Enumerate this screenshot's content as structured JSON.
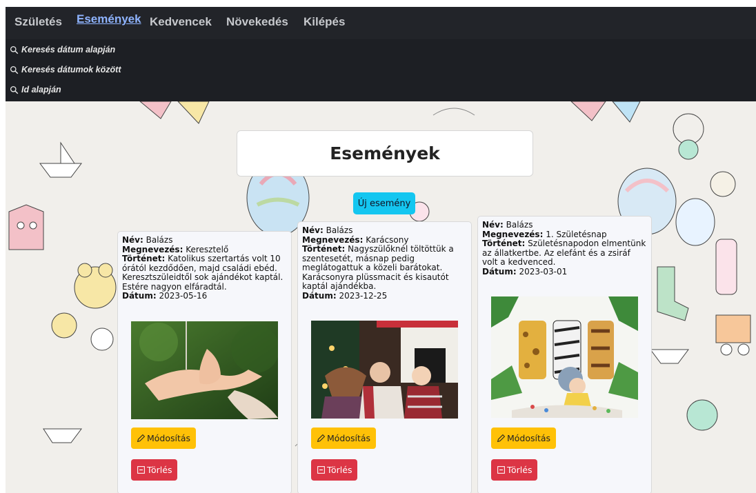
{
  "nav": {
    "items": [
      {
        "label": "Születés"
      },
      {
        "label": "Események"
      },
      {
        "label": "Kedvencek"
      },
      {
        "label": "Növekedés"
      },
      {
        "label": "Kilépés"
      }
    ]
  },
  "subnav": {
    "items": [
      {
        "label": "Keresés dátum alapján",
        "icon": "search-icon"
      },
      {
        "label": "Keresés dátumok között",
        "icon": "search-icon"
      },
      {
        "label": "Id alapján",
        "icon": "search-icon"
      }
    ]
  },
  "page": {
    "title": "Események",
    "new_button": "Új esemény"
  },
  "labels": {
    "name": "Név:",
    "title": "Megnevezés:",
    "story": "Történet:",
    "date": "Dátum:",
    "edit": "Módosítás",
    "delete": "Törlés"
  },
  "cards": [
    {
      "name": "Balázs",
      "title": "Keresztelő",
      "story": "Katolikus szertartás volt 10 órától kezdődően, majd családi ebéd. Keresztszüleidtől sok ajándékot kaptál. Estére nagyon elfáradtál.",
      "date": "2023-05-16"
    },
    {
      "name": "Balázs",
      "title": "Karácsony",
      "story": "Nagyszülőknél töltöttük a szentesetét, másnap pedig meglátogattuk a közeli barátokat. Karácsonyra plüssmacit és kisautót kaptál ajándékba.",
      "date": "2023-12-25"
    },
    {
      "name": "Balázs",
      "title": "1. Születésnap",
      "story": "Születésnapodon elmentünk az állatkertbe. Az elefánt és a zsiráf volt a kedvenced.",
      "date": "2023-03-01"
    }
  ],
  "colors": {
    "navbar": "#222429",
    "active_link": "#8fb4ff",
    "new_button": "#14c6f0",
    "edit_button": "#ffc107",
    "delete_button": "#dc3545"
  }
}
